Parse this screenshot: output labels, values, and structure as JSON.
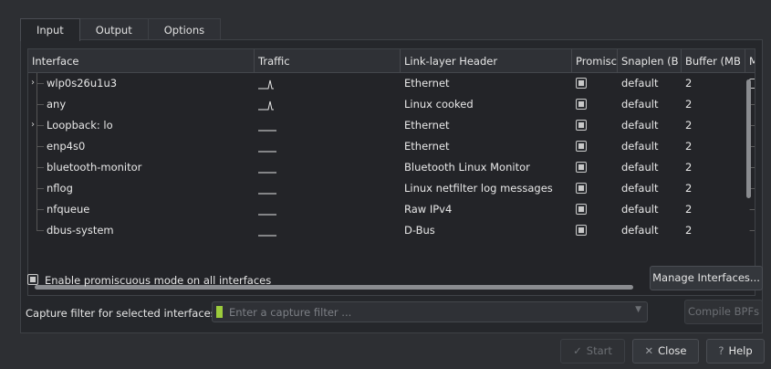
{
  "tabs": [
    {
      "label": "Input",
      "active": true
    },
    {
      "label": "Output",
      "active": false
    },
    {
      "label": "Options",
      "active": false
    }
  ],
  "table": {
    "headers": [
      "Interface",
      "Traffic",
      "Link-layer Header",
      "Promisc",
      "Snaplen (B",
      "Buffer (MB",
      "M"
    ],
    "rows": [
      {
        "interface": "wlp0s26u1u3",
        "expandable": true,
        "traffic": "spike",
        "link": "Ethernet",
        "promisc": true,
        "snaplen": "default",
        "buffer": "2",
        "monitor": "box"
      },
      {
        "interface": "any",
        "expandable": false,
        "traffic": "spike",
        "link": "Linux cooked",
        "promisc": true,
        "snaplen": "default",
        "buffer": "2",
        "monitor": "—"
      },
      {
        "interface": "Loopback: lo",
        "expandable": true,
        "traffic": "flat",
        "link": "Ethernet",
        "promisc": true,
        "snaplen": "default",
        "buffer": "2",
        "monitor": "—"
      },
      {
        "interface": "enp4s0",
        "expandable": false,
        "traffic": "flat",
        "link": "Ethernet",
        "promisc": true,
        "snaplen": "default",
        "buffer": "2",
        "monitor": "—"
      },
      {
        "interface": "bluetooth-monitor",
        "expandable": false,
        "traffic": "flat",
        "link": "Bluetooth Linux Monitor",
        "promisc": true,
        "snaplen": "default",
        "buffer": "2",
        "monitor": "—"
      },
      {
        "interface": "nflog",
        "expandable": false,
        "traffic": "flat",
        "link": "Linux netfilter log messages",
        "promisc": true,
        "snaplen": "default",
        "buffer": "2",
        "monitor": "—"
      },
      {
        "interface": "nfqueue",
        "expandable": false,
        "traffic": "flat",
        "link": "Raw IPv4",
        "promisc": true,
        "snaplen": "default",
        "buffer": "2",
        "monitor": "—"
      },
      {
        "interface": "dbus-system",
        "expandable": false,
        "traffic": "flat",
        "link": "D-Bus",
        "promisc": true,
        "snaplen": "default",
        "buffer": "2",
        "monitor": "—"
      }
    ]
  },
  "promisc_all": {
    "label": "Enable promiscuous mode on all interfaces",
    "checked": true
  },
  "manage_button": "Manage Interfaces...",
  "filter": {
    "label": "Capture filter for selected interfaces:",
    "placeholder": "Enter a capture filter ..."
  },
  "compile_button": "Compile BPFs",
  "footer": {
    "start": "Start",
    "close": "Close",
    "help": "Help"
  },
  "icons": {
    "expand": "chevron-right-icon",
    "filter": "bookmark-icon",
    "start": "check-icon",
    "close": "x-icon",
    "help": "question-icon"
  },
  "colors": {
    "filter_bookmark": "#9ccc3c"
  }
}
